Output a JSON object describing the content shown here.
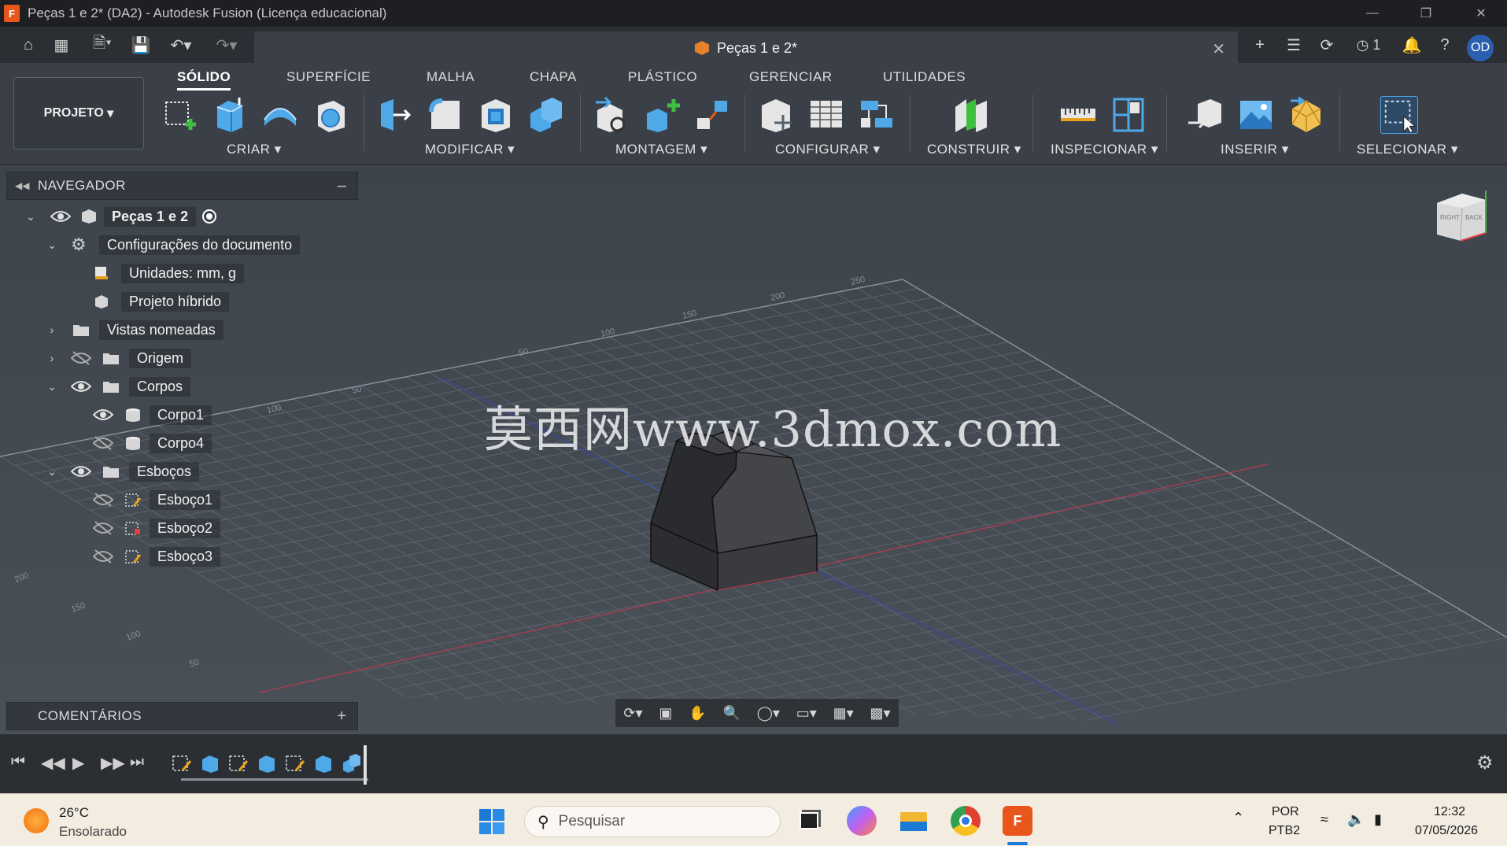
{
  "window": {
    "title": "Peças 1 e 2* (DA2) - Autodesk Fusion (Licença educacional)",
    "app_icon_letter": "F"
  },
  "quick_access": {
    "doc_tab_label": "Peças 1 e 2*",
    "job_count": "1",
    "user_initials": "OD"
  },
  "ribbon": {
    "tabs": [
      "SÓLIDO",
      "SUPERFÍCIE",
      "MALHA",
      "CHAPA",
      "PLÁSTICO",
      "GERENCIAR",
      "UTILIDADES"
    ],
    "active_tab": "SÓLIDO",
    "project_button": "PROJETO",
    "groups": [
      "CRIAR",
      "MODIFICAR",
      "MONTAGEM",
      "CONFIGURAR",
      "CONSTRUIR",
      "INSPECIONAR",
      "INSERIR",
      "SELECIONAR"
    ]
  },
  "navigator": {
    "title": "NAVEGADOR",
    "root": "Peças 1 e 2",
    "items": [
      {
        "label": "Configurações do documento"
      },
      {
        "label": "Unidades: mm, g"
      },
      {
        "label": "Projeto híbrido"
      },
      {
        "label": "Vistas nomeadas"
      },
      {
        "label": "Origem"
      },
      {
        "label": "Corpos"
      },
      {
        "label": "Corpo1"
      },
      {
        "label": "Corpo4"
      },
      {
        "label": "Esboços"
      },
      {
        "label": "Esboço1"
      },
      {
        "label": "Esboço2"
      },
      {
        "label": "Esboço3"
      }
    ]
  },
  "comments": {
    "title": "COMENTÁRIOS"
  },
  "viewcube": {
    "back_label": "BACK",
    "side_label": "RIGHT"
  },
  "watermark": "莫西网www.3dmox.com",
  "grid_labels": [
    "200",
    "150",
    "100",
    "50",
    "250",
    "200",
    "150",
    "100",
    "50",
    "50",
    "100",
    "150",
    "200"
  ],
  "taskbar": {
    "weather_temp": "26°C",
    "weather_desc": "Ensolarado",
    "search_placeholder": "Pesquisar",
    "lang_top": "POR",
    "lang_bottom": "PTB2",
    "time": "12:32",
    "date": "07/05/2026"
  },
  "colors": {
    "accent_orange": "#e8561c",
    "avatar_blue": "#2a5fb0",
    "viewport_bg": "#444a52"
  }
}
